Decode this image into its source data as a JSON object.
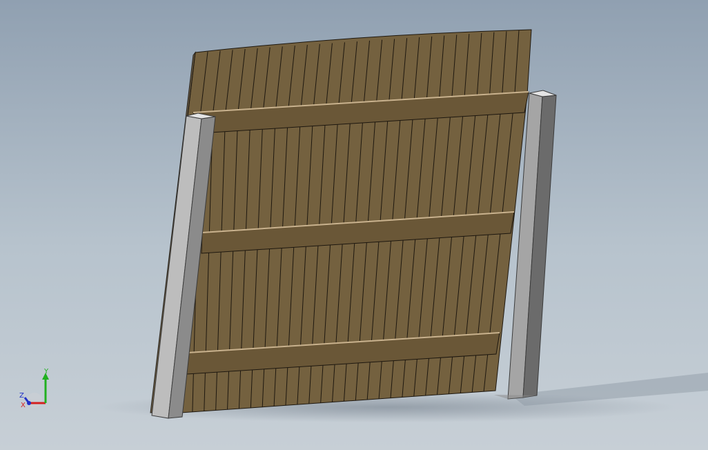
{
  "viewport": {
    "background_top": "#90a0b1",
    "background_bottom": "#c7cfd6"
  },
  "model": {
    "part": "wooden-fence-panel",
    "board_color": "#74613f",
    "board_edge_color": "#1d170f",
    "rail_color": "#6a5737",
    "rail_highlight": "#c9b28e",
    "post_front_color": "#9b9b9b",
    "post_side_color": "#6b6b6b",
    "post_top_color": "#e4e4e4"
  },
  "triad": {
    "icon": "coordinate-axes-icon",
    "x_label": "X",
    "y_label": "Y",
    "z_label": "Z",
    "x_color": "#d42020",
    "y_color": "#20b020",
    "z_color": "#2030c8"
  }
}
